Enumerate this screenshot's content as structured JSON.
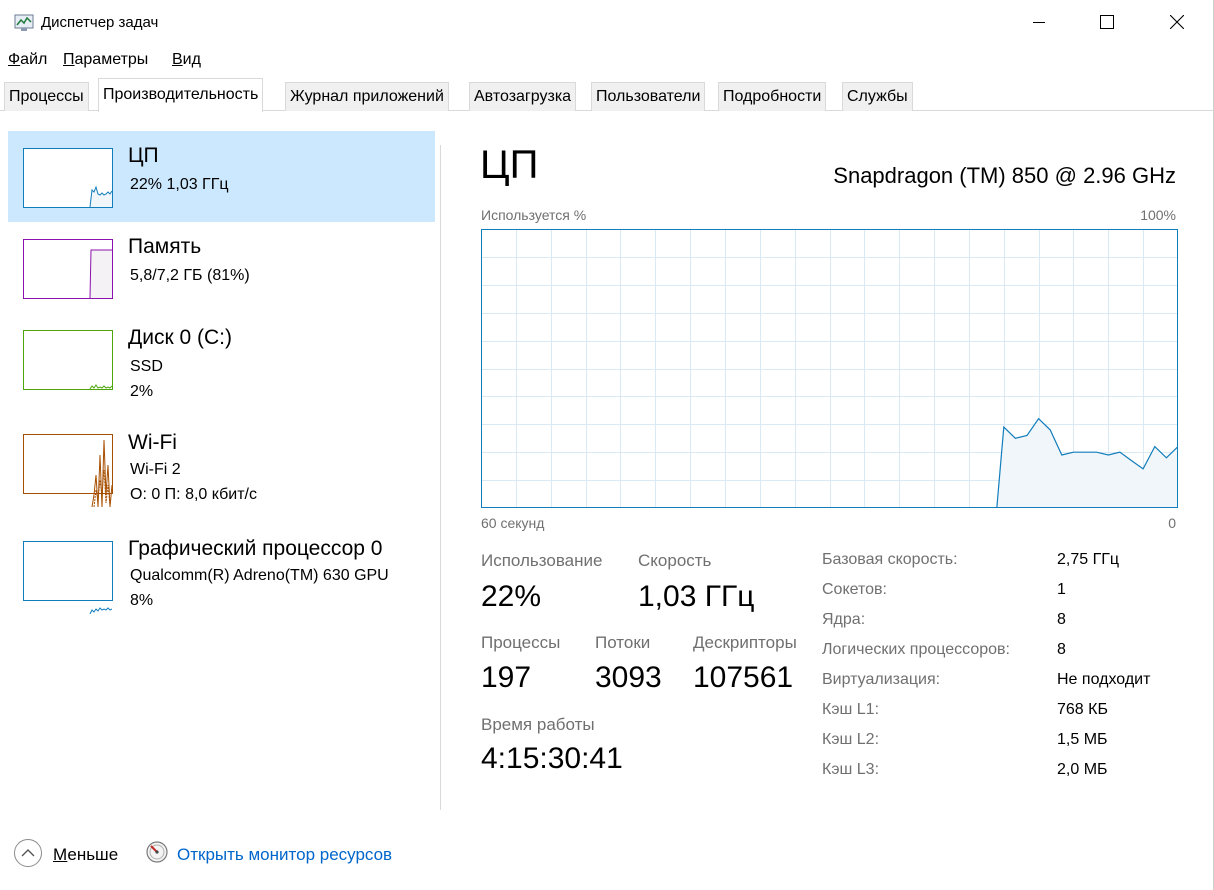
{
  "window": {
    "title": "Диспетчер задач",
    "controls": {
      "minimize": "minimize-icon",
      "maximize": "maximize-icon",
      "close": "close-icon"
    }
  },
  "menu": {
    "file": "Файл",
    "file_key": "Ф",
    "file_rest": "айл",
    "params_key": "П",
    "params_rest": "араметры",
    "view_key": "В",
    "view_rest": "ид"
  },
  "tabs": [
    {
      "label": "Процессы"
    },
    {
      "label": "Производительность",
      "active": true
    },
    {
      "label": "Журнал приложений"
    },
    {
      "label": "Автозагрузка"
    },
    {
      "label": "Пользователи"
    },
    {
      "label": "Подробности"
    },
    {
      "label": "Службы"
    }
  ],
  "resources": [
    {
      "title": "ЦП",
      "line1": "22%  1,03 ГГц",
      "color": "#117dbb",
      "selected": true,
      "history": [
        0,
        0,
        0,
        0,
        0,
        0,
        0,
        0,
        0,
        0,
        0,
        0,
        0,
        0,
        0,
        0,
        0,
        0,
        0,
        0,
        0,
        0,
        0,
        0,
        0,
        0,
        0,
        0,
        0,
        0,
        0,
        0,
        0,
        0,
        0,
        0,
        0,
        0,
        0,
        0,
        0,
        0,
        0,
        0,
        0,
        0,
        0,
        0,
        0,
        0,
        0,
        0,
        0,
        0,
        0,
        0,
        0,
        0,
        0,
        0,
        0,
        0,
        0,
        0,
        0,
        0,
        0,
        0,
        0,
        0,
        0,
        0,
        0,
        0,
        0,
        0,
        0,
        0,
        0,
        0,
        0,
        0,
        0,
        0,
        0,
        0,
        0,
        0,
        0,
        0,
        0,
        0,
        0,
        0,
        0,
        0,
        0,
        0,
        0,
        0,
        0,
        0,
        0,
        0,
        0,
        0,
        0,
        0,
        0,
        0,
        0,
        0,
        0,
        0,
        0,
        0,
        0,
        0,
        0,
        0,
        0,
        0,
        0,
        0,
        0,
        0,
        0,
        0,
        0,
        0,
        0,
        0,
        0,
        0,
        0,
        0,
        0,
        0,
        0,
        0,
        0,
        0,
        0,
        0,
        0,
        0,
        0,
        0,
        0,
        0,
        0,
        0,
        0,
        0,
        0,
        0,
        0,
        0,
        0,
        0,
        0,
        0,
        0,
        0,
        0,
        0,
        0,
        0,
        0,
        0,
        0,
        0,
        0,
        0,
        0,
        0,
        0,
        0,
        0,
        0,
        0,
        0,
        0,
        0,
        0,
        0,
        0,
        0,
        0,
        0,
        0,
        0,
        0,
        0,
        0,
        0,
        0,
        0,
        0,
        0
      ]
    },
    {
      "title": "Память",
      "line1": "5,8/7,2 ГБ (81%)",
      "color": "#8b12ae"
    },
    {
      "title": "Диск 0 (C:)",
      "line1": "SSD",
      "line2": "2%",
      "color": "#4da60c"
    },
    {
      "title": "Wi-Fi",
      "line1": "Wi-Fi 2",
      "line2": "О: 0  П: 8,0 кбит/с",
      "color": "#a74f01"
    },
    {
      "title": "Графический процессор 0",
      "line1": "Qualcomm(R) Adreno(TM) 630 GPU",
      "line2": "8%",
      "color": "#117dbb"
    }
  ],
  "detail": {
    "title": "ЦП",
    "cpu_name": "Snapdragon (TM) 850 @ 2.96 GHz",
    "graph_label_top_left": "Используется %",
    "graph_label_top_right": "100%",
    "graph_label_bottom_left": "60 секунд",
    "graph_label_bottom_right": "0",
    "utilization_label": "Использование",
    "utilization_value": "22%",
    "speed_label": "Скорость",
    "speed_value": "1,03 ГГц",
    "processes_label": "Процессы",
    "processes_value": "197",
    "threads_label": "Потоки",
    "threads_value": "3093",
    "handles_label": "Дескрипторы",
    "handles_value": "107561",
    "uptime_label": "Время работы",
    "uptime_value": "4:15:30:41",
    "specs": [
      {
        "label": "Базовая скорость:",
        "value": "2,75 ГГц"
      },
      {
        "label": "Сокетов:",
        "value": "1"
      },
      {
        "label": "Ядра:",
        "value": "8"
      },
      {
        "label": "Логических процессоров:",
        "value": "8"
      },
      {
        "label": "Виртуализация:",
        "value": "Не подходит"
      },
      {
        "label": "Кэш L1:",
        "value": "768 КБ"
      },
      {
        "label": "Кэш L2:",
        "value": "1,5 МБ"
      },
      {
        "label": "Кэш L3:",
        "value": "2,0 МБ"
      }
    ],
    "cpu_history_pct": [
      29,
      25,
      26,
      32,
      28,
      19,
      20,
      20,
      20,
      19,
      20,
      17,
      14,
      22,
      18,
      22
    ],
    "graph_color": "#117dbb",
    "graph_fill": "#f1f6fa",
    "grid_color": "#d9eaf4"
  },
  "footer": {
    "less_key": "М",
    "less_rest": "еньше",
    "resource_monitor": "Открыть монитор ресурсов"
  }
}
